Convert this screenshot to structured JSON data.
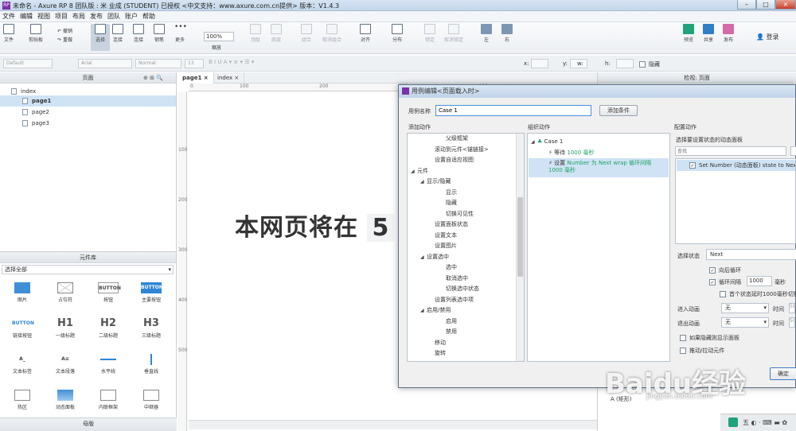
{
  "window": {
    "title": "未命名 - Axure RP 8 团队版 : 米 业成 (STUDENT) 已授权    <中文支持：www.axure.com.cn提供> 版本：V1.4.3",
    "app_icon": "RP"
  },
  "menu": [
    "文件",
    "编辑",
    "视图",
    "项目",
    "布局",
    "发布",
    "团队",
    "账户",
    "帮助"
  ],
  "toolbar": {
    "file": "文件",
    "clipboard": "剪贴板",
    "undo": "撤销",
    "redo": "重做",
    "select": "选择",
    "connect": "连接",
    "pen": "钢笔",
    "more": "更多",
    "zoom_value": "100%",
    "zoom_label": "缩放",
    "top": "顶层",
    "bottom": "底层",
    "group": "组合",
    "ungroup": "取消组合",
    "align": "对齐",
    "distribute": "分布",
    "lock": "锁定",
    "unlock": "取消锁定",
    "left": "左",
    "right": "右",
    "preview": "预览",
    "share": "共享",
    "publish": "发布",
    "login": "登录"
  },
  "formatbar": {
    "style": "Default",
    "font": "Arial",
    "weight": "Normal",
    "size": "13",
    "x_label": "x:",
    "y_label": "y:",
    "w_label": "w:",
    "h_label": "h:",
    "hidden_label": "隐藏"
  },
  "pages_panel": {
    "title": "页面",
    "root": "index",
    "items": [
      "page1",
      "page2",
      "page3"
    ]
  },
  "library_panel": {
    "title": "元件库",
    "category": "选择全部",
    "widgets": [
      {
        "label": "图片",
        "icon": "image-icon"
      },
      {
        "label": "占位符",
        "icon": "placeholder-icon"
      },
      {
        "label": "按钮",
        "icon": "button-icon",
        "text": "BUTTON"
      },
      {
        "label": "主要按钮",
        "icon": "primary-button-icon",
        "text": "BUTTON"
      },
      {
        "label": "链接按钮",
        "icon": "link-button-icon",
        "text": "BUTTON"
      },
      {
        "label": "一级标题",
        "icon": "h1-icon",
        "text": "H1"
      },
      {
        "label": "二级标题",
        "icon": "h2-icon",
        "text": "H2"
      },
      {
        "label": "三级标题",
        "icon": "h3-icon",
        "text": "H3"
      },
      {
        "label": "文本标签",
        "icon": "text-label-icon",
        "text": "A_"
      },
      {
        "label": "文本段落",
        "icon": "text-paragraph-icon",
        "text": "A≡"
      },
      {
        "label": "水平线",
        "icon": "horizontal-line-icon"
      },
      {
        "label": "垂直线",
        "icon": "vertical-line-icon"
      },
      {
        "label": "热区",
        "icon": "hotspot-icon"
      },
      {
        "label": "动态面板",
        "icon": "dynamic-panel-icon"
      },
      {
        "label": "内联框架",
        "icon": "inline-frame-icon"
      },
      {
        "label": "中继器",
        "icon": "repeater-icon"
      }
    ]
  },
  "masters_panel": {
    "title": "母版"
  },
  "canvas": {
    "tabs": [
      "page1",
      "index"
    ],
    "ruler_h": [
      "0",
      "100",
      "200",
      "300",
      "400"
    ],
    "ruler_v": [
      "100",
      "200",
      "300",
      "400",
      "500"
    ],
    "big_text": "本网页将在",
    "big_number": "5",
    "big_tail": "秒"
  },
  "inspector": {
    "title": "检视: 页面",
    "bottom_label": "A (矩形)"
  },
  "dialog": {
    "title": "用例编辑<页面载入时>",
    "case_name_label": "用例名称",
    "case_name_value": "Case 1",
    "add_condition": "添加条件",
    "add_action_header": "添加动作",
    "organize_header": "组织动作",
    "config_header": "配置动作",
    "actions": [
      {
        "label": "父级框架",
        "level": 3
      },
      {
        "label": "滚动到元件<锚链接>",
        "level": 2
      },
      {
        "label": "设置自适应视图",
        "level": 2
      },
      {
        "label": "元件",
        "level": 0,
        "expand": true
      },
      {
        "label": "显示/隐藏",
        "level": 1,
        "expand": true
      },
      {
        "label": "显示",
        "level": 3
      },
      {
        "label": "隐藏",
        "level": 3
      },
      {
        "label": "切换可见性",
        "level": 3
      },
      {
        "label": "设置面板状态",
        "level": 2
      },
      {
        "label": "设置文本",
        "level": 2
      },
      {
        "label": "设置图片",
        "level": 2
      },
      {
        "label": "设置选中",
        "level": 1,
        "expand": true
      },
      {
        "label": "选中",
        "level": 3
      },
      {
        "label": "取消选中",
        "level": 3
      },
      {
        "label": "切换选中状态",
        "level": 3
      },
      {
        "label": "设置列表选中项",
        "level": 2
      },
      {
        "label": "启用/禁用",
        "level": 1,
        "expand": true
      },
      {
        "label": "启用",
        "level": 3
      },
      {
        "label": "禁用",
        "level": 3
      },
      {
        "label": "移动",
        "level": 2
      },
      {
        "label": "旋转",
        "level": 2
      }
    ],
    "case_label": "Case 1",
    "organized": [
      {
        "prefix": "等待",
        "value": "1000 毫秒"
      },
      {
        "prefix": "设置",
        "value": "Number 为 Next wrap 循环间隔 1000 毫秒"
      }
    ],
    "config_sub": "选择要设置状态的动态面板",
    "search_placeholder": "查找",
    "panel_item": "Set Number (动态面板) state to Next wrap",
    "select_state_label": "选择状态",
    "select_state_value": "Next",
    "loop_back": "向后循环",
    "loop_interval": "循环间隔",
    "interval_value": "1000",
    "interval_unit": "毫秒",
    "first_delay": "首个状态延时1000毫秒切换",
    "enter_anim_label": "进入动画",
    "enter_anim_value": "无",
    "exit_anim_label": "退出动画",
    "exit_anim_value": "无",
    "time_label": "时间",
    "time_value": "50",
    "show_if_hidden": "如果隐藏则显示面板",
    "push_widgets": "推动/拉动元件",
    "ok_button": "确定"
  },
  "watermark": {
    "brand": "Baidu经验",
    "url": "jingyan.baidu.com"
  },
  "colors": {
    "selection": "#cfe3f5",
    "case_action": "#21a366",
    "accent": "#7b2fa8"
  }
}
